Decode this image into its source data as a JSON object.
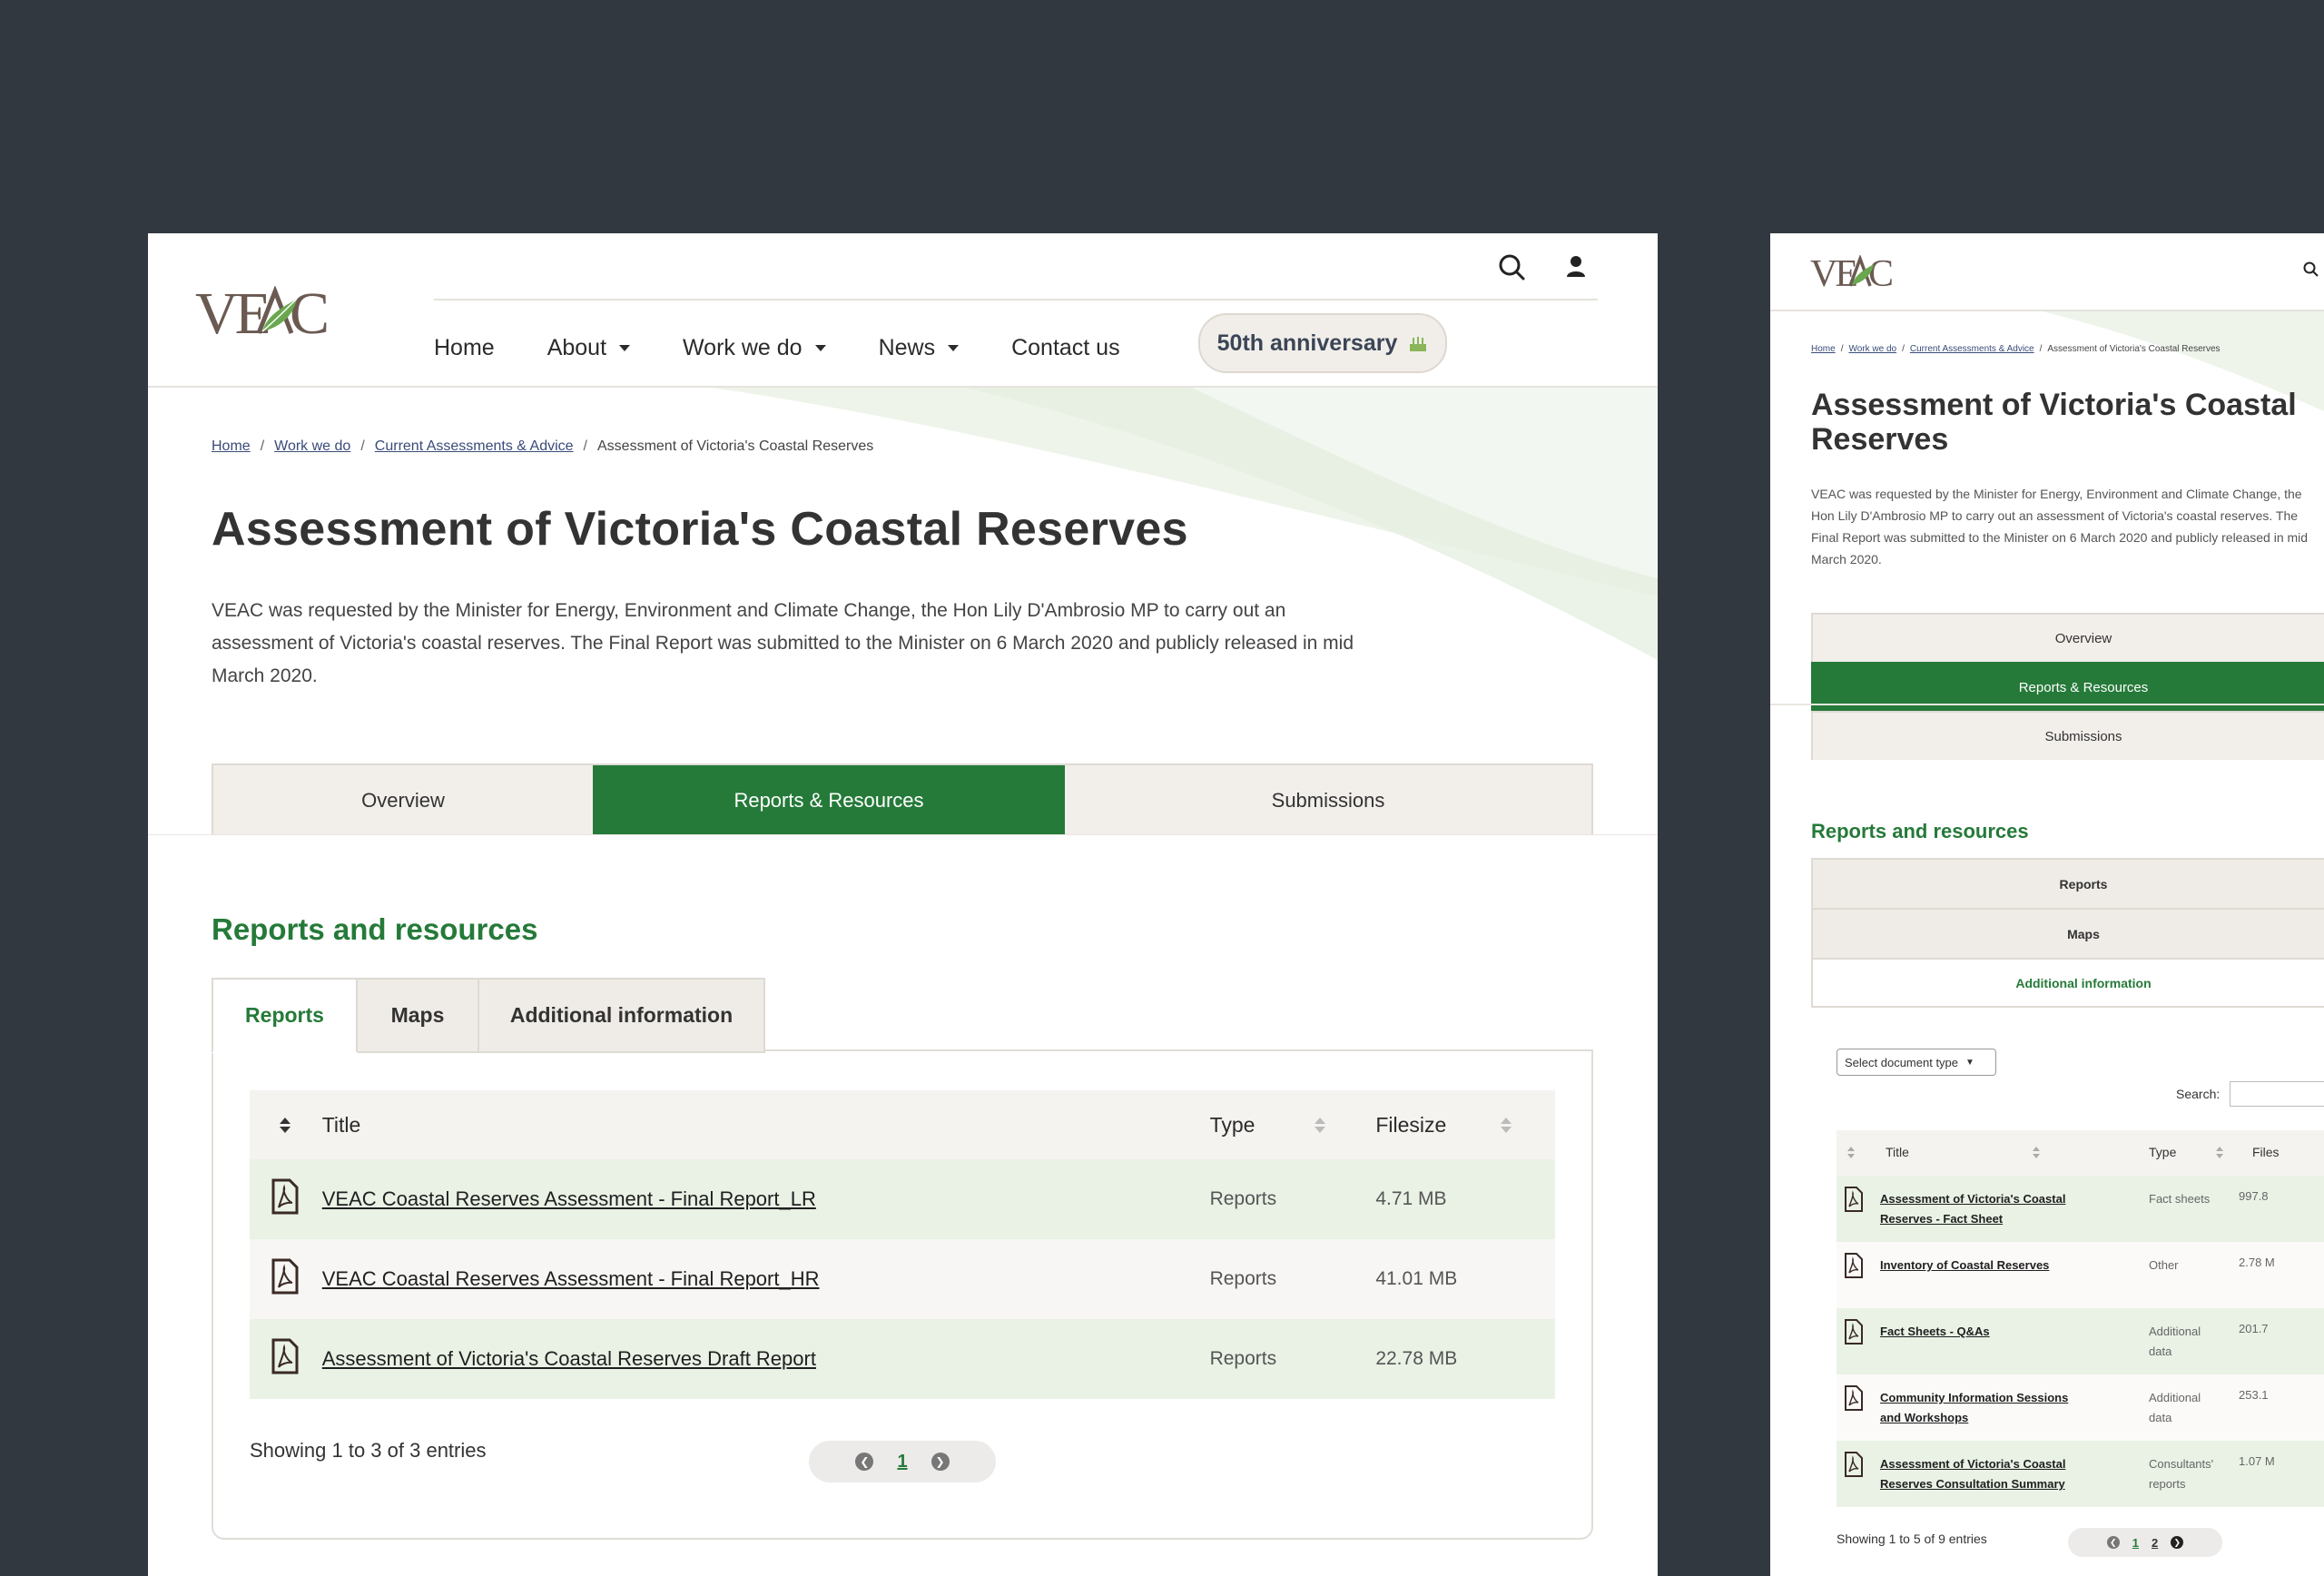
{
  "desktop": {
    "logo_text": "VEAC",
    "nav": [
      "Home",
      "About",
      "Work we do",
      "News",
      "Contact us"
    ],
    "anniversary_label": "50th anniversary",
    "breadcrumb": [
      "Home",
      "Work we do",
      "Current Assessments & Advice",
      "Assessment of Victoria's Coastal Reserves"
    ],
    "title": "Assessment of Victoria's Coastal Reserves",
    "intro": "VEAC was requested by the Minister for Energy, Environment and Climate Change, the Hon Lily D'Ambrosio MP to carry out an assessment of Victoria's coastal reserves. The Final Report was submitted to the Minister on 6 March 2020 and publicly released in mid March 2020.",
    "tabs": [
      "Overview",
      "Reports & Resources",
      "Submissions"
    ],
    "section_title": "Reports and resources",
    "subtabs": [
      "Reports",
      "Maps",
      "Additional information"
    ],
    "table": {
      "headers": [
        "Title",
        "Type",
        "Filesize"
      ],
      "rows": [
        {
          "title": "VEAC Coastal Reserves Assessment - Final Report_LR",
          "type": "Reports",
          "size": "4.71 MB"
        },
        {
          "title": "VEAC Coastal Reserves Assessment - Final Report_HR",
          "type": "Reports",
          "size": "41.01 MB"
        },
        {
          "title": "Assessment of Victoria's Coastal Reserves Draft Report",
          "type": "Reports",
          "size": "22.78 MB"
        }
      ]
    },
    "showing": "Showing 1 to 3 of 3 entries",
    "page": "1"
  },
  "mobile": {
    "logo_text": "VEAC",
    "breadcrumb": [
      "Home",
      "Work we do",
      "Current Assessments & Advice",
      "Assessment of Victoria's Coastal Reserves"
    ],
    "title": "Assessment of Victoria's Coastal Reserves",
    "intro": "VEAC was requested by the Minister for Energy, Environment and Climate Change, the Hon Lily D'Ambrosio MP to carry out an assessment of Victoria's coastal reserves. The Final Report was submitted to the Minister on 6 March 2020 and publicly released in mid March 2020.",
    "tabs": [
      "Overview",
      "Reports & Resources",
      "Submissions"
    ],
    "section_title": "Reports and resources",
    "subtabs": [
      "Reports",
      "Maps",
      "Additional information"
    ],
    "select_label": "Select document type",
    "search_label": "Search:",
    "headers": [
      "Title",
      "Type",
      "Files"
    ],
    "rows": [
      {
        "title": "Assessment of Victoria's Coastal Reserves - Fact Sheet",
        "type": "Fact sheets",
        "size": "997.8"
      },
      {
        "title": "Inventory of Coastal Reserves",
        "type": "Other",
        "size": "2.78 M"
      },
      {
        "title": "Fact Sheets - Q&As",
        "type": "Additional data",
        "size": "201.7"
      },
      {
        "title": "Community Information Sessions and Workshops",
        "type": "Additional data",
        "size": "253.1"
      },
      {
        "title": "Assessment of Victoria's Coastal Reserves Consultation Summary",
        "type": "Consultants' reports",
        "size": "1.07 M"
      }
    ],
    "showing": "Showing 1 to 5 of 9 entries",
    "pages": [
      "1",
      "2"
    ]
  },
  "colors": {
    "background": "#323840",
    "brand_green": "#257a39",
    "row_tint": "#e9f2e5",
    "logo_brown": "#6b5a52"
  }
}
